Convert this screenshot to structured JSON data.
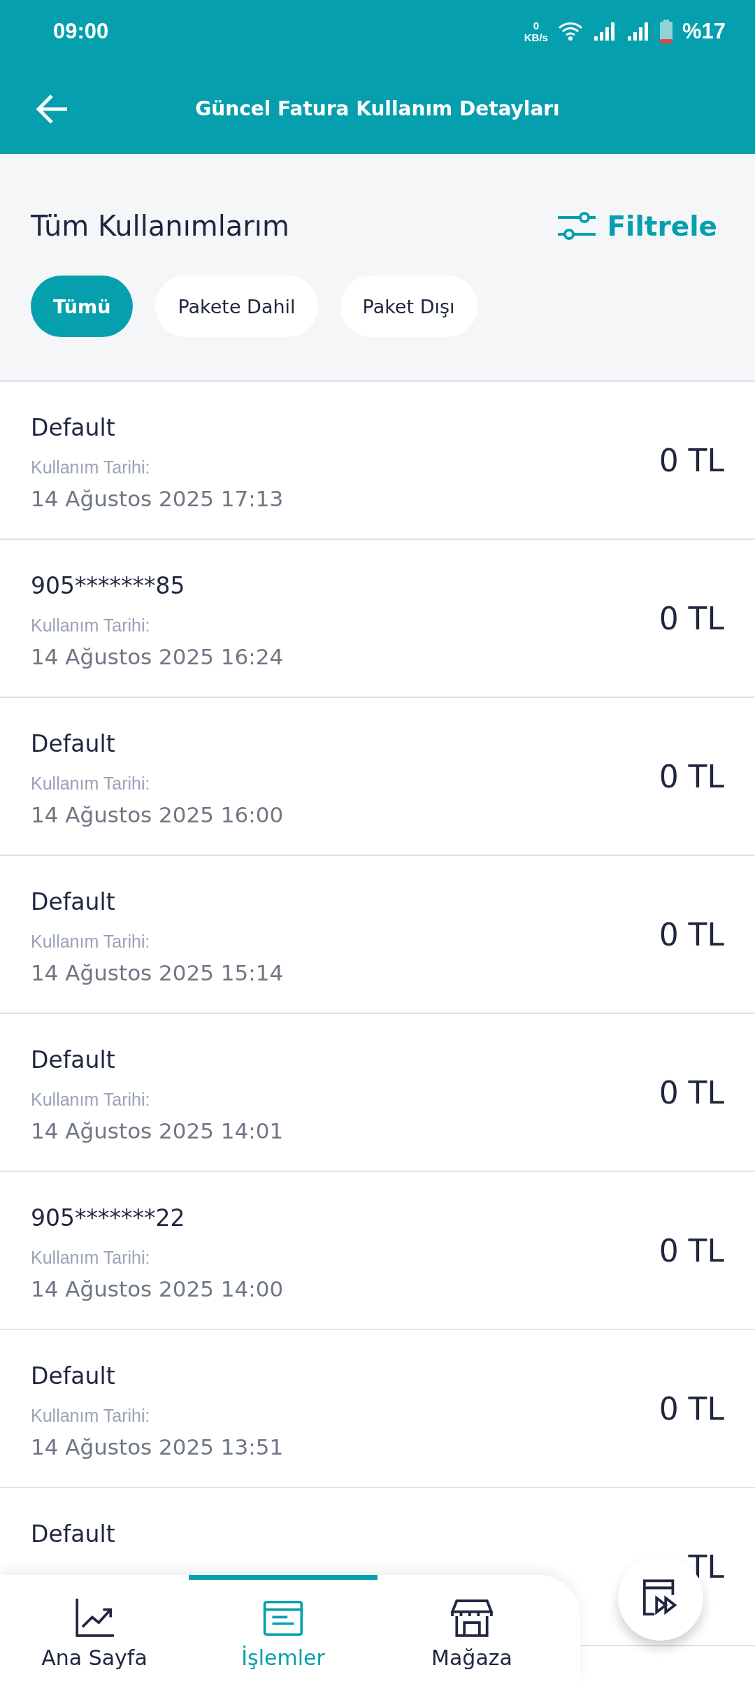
{
  "status_bar": {
    "time": "09:00",
    "net_speed": "0",
    "net_unit": "KB/s",
    "battery": "%17"
  },
  "header": {
    "title": "Güncel Fatura Kullanım Detayları"
  },
  "section": {
    "title": "Tüm Kullanımlarım",
    "filter_label": "Filtrele"
  },
  "chips": [
    {
      "label": "Tümü",
      "selected": true
    },
    {
      "label": "Pakete Dahil",
      "selected": false
    },
    {
      "label": "Paket Dışı",
      "selected": false
    }
  ],
  "usages": [
    {
      "title": "Default",
      "date_label": "Kullanım Tarihi:",
      "date": "14 Ağustos 2025 17:13",
      "amount": "0 TL"
    },
    {
      "title": "905*******85",
      "date_label": "Kullanım Tarihi:",
      "date": "14 Ağustos 2025 16:24",
      "amount": "0 TL"
    },
    {
      "title": "Default",
      "date_label": "Kullanım Tarihi:",
      "date": "14 Ağustos 2025 16:00",
      "amount": "0 TL"
    },
    {
      "title": "Default",
      "date_label": "Kullanım Tarihi:",
      "date": "14 Ağustos 2025 15:14",
      "amount": "0 TL"
    },
    {
      "title": "Default",
      "date_label": "Kullanım Tarihi:",
      "date": "14 Ağustos 2025 14:01",
      "amount": "0 TL"
    },
    {
      "title": "905*******22",
      "date_label": "Kullanım Tarihi:",
      "date": "14 Ağustos 2025 14:00",
      "amount": "0 TL"
    },
    {
      "title": "Default",
      "date_label": "Kullanım Tarihi:",
      "date": "14 Ağustos 2025 13:51",
      "amount": "0 TL"
    },
    {
      "title": "Default",
      "amount": "TL"
    }
  ],
  "bottom_nav": [
    {
      "label": "Ana Sayfa",
      "kind": "chart",
      "selected": false
    },
    {
      "label": "İşlemler",
      "kind": "window",
      "selected": true
    },
    {
      "label": "Mağaza",
      "kind": "store",
      "selected": false
    }
  ]
}
